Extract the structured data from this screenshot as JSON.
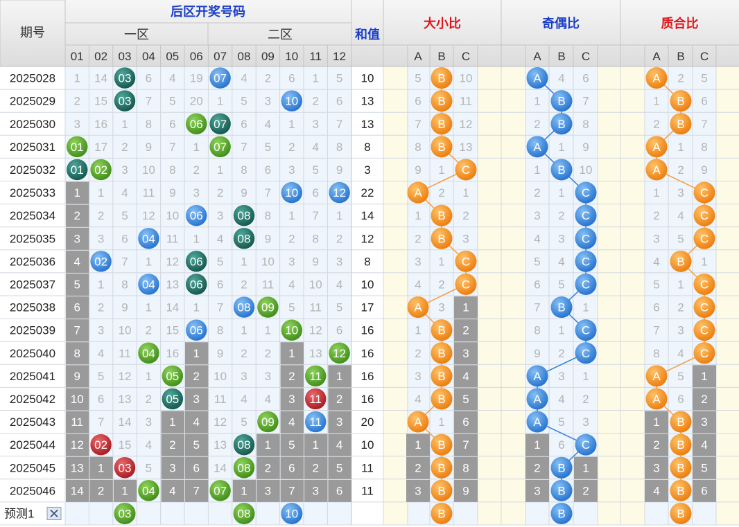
{
  "header": {
    "period_label": "期号",
    "back_title": "后区开奖号码",
    "zone1_label": "一区",
    "zone2_label": "二区",
    "sum_label": "和值",
    "size_title": "大小比",
    "parity_title": "奇偶比",
    "prime_title": "质合比",
    "numbers": [
      "01",
      "02",
      "03",
      "04",
      "05",
      "06",
      "07",
      "08",
      "09",
      "10",
      "11",
      "12"
    ],
    "abc": [
      "A",
      "B",
      "C"
    ]
  },
  "colors": {
    "blue_title": "#1a3ec8",
    "red_title": "#e0151b",
    "ball_dark_teal": "#1f6e63",
    "ball_green": "#55a92a",
    "ball_blue": "#3b8be0",
    "ball_red": "#c8282e",
    "ball_orange": "#f28a1c",
    "gray_cell": "#9a9a9a"
  },
  "prediction": {
    "label": "预测1",
    "close_icon": "close-icon",
    "numbers": [
      "03",
      "08",
      "10"
    ],
    "size": "B",
    "parity": "B",
    "prime": "B"
  },
  "chart_data": {
    "type": "table",
    "columns": [
      "期号",
      "01",
      "02",
      "03",
      "04",
      "05",
      "06",
      "07",
      "08",
      "09",
      "10",
      "11",
      "12",
      "和值",
      "大小比 A",
      "大小比 B",
      "大小比 C",
      "奇偶比 A",
      "奇偶比 B",
      "奇偶比 C",
      "质合比 A",
      "质合比 B",
      "质合比 C"
    ],
    "rows": [
      {
        "period": "2025028",
        "nums": [
          "1",
          "14",
          "03",
          "6",
          "4",
          "19",
          "07",
          "4",
          "2",
          "6",
          "1",
          "5"
        ],
        "balls": [
          3,
          7
        ],
        "sum": "10",
        "size": [
          "5",
          "B",
          "10"
        ],
        "parity": [
          "A",
          "4",
          "6"
        ],
        "prime": [
          "A",
          "2",
          "5"
        ]
      },
      {
        "period": "2025029",
        "nums": [
          "2",
          "15",
          "03",
          "7",
          "5",
          "20",
          "1",
          "5",
          "3",
          "10",
          "2",
          "6"
        ],
        "balls": [
          3,
          10
        ],
        "sum": "13",
        "size": [
          "6",
          "B",
          "11"
        ],
        "parity": [
          "1",
          "B",
          "7"
        ],
        "prime": [
          "1",
          "B",
          "6"
        ]
      },
      {
        "period": "2025030",
        "nums": [
          "3",
          "16",
          "1",
          "8",
          "6",
          "06",
          "07",
          "6",
          "4",
          "1",
          "3",
          "7"
        ],
        "balls": [
          6,
          7
        ],
        "sum": "13",
        "size": [
          "7",
          "B",
          "12"
        ],
        "parity": [
          "2",
          "B",
          "8"
        ],
        "prime": [
          "2",
          "B",
          "7"
        ]
      },
      {
        "period": "2025031",
        "nums": [
          "01",
          "17",
          "2",
          "9",
          "7",
          "1",
          "07",
          "7",
          "5",
          "2",
          "4",
          "8"
        ],
        "balls": [
          1,
          7
        ],
        "sum": "8",
        "size": [
          "8",
          "B",
          "13"
        ],
        "parity": [
          "A",
          "1",
          "9"
        ],
        "prime": [
          "A",
          "1",
          "8"
        ]
      },
      {
        "period": "2025032",
        "nums": [
          "01",
          "02",
          "3",
          "10",
          "8",
          "2",
          "1",
          "8",
          "6",
          "3",
          "5",
          "9"
        ],
        "balls": [
          1,
          2
        ],
        "sum": "3",
        "size": [
          "9",
          "1",
          "C"
        ],
        "parity": [
          "1",
          "B",
          "10"
        ],
        "prime": [
          "A",
          "2",
          "9"
        ]
      },
      {
        "period": "2025033",
        "nums": [
          "1",
          "1",
          "4",
          "11",
          "9",
          "3",
          "2",
          "9",
          "7",
          "10",
          "6",
          "12"
        ],
        "balls": [
          10,
          12
        ],
        "sum": "22",
        "size": [
          "A",
          "2",
          "1"
        ],
        "parity": [
          "2",
          "1",
          "C"
        ],
        "prime": [
          "1",
          "3",
          "C"
        ]
      },
      {
        "period": "2025034",
        "nums": [
          "2",
          "2",
          "5",
          "12",
          "10",
          "06",
          "3",
          "08",
          "8",
          "1",
          "7",
          "1"
        ],
        "balls": [
          6,
          8
        ],
        "sum": "14",
        "size": [
          "1",
          "B",
          "2"
        ],
        "parity": [
          "3",
          "2",
          "C"
        ],
        "prime": [
          "2",
          "4",
          "C"
        ]
      },
      {
        "period": "2025035",
        "nums": [
          "3",
          "3",
          "6",
          "04",
          "11",
          "1",
          "4",
          "08",
          "9",
          "2",
          "8",
          "2"
        ],
        "balls": [
          4,
          8
        ],
        "sum": "12",
        "size": [
          "2",
          "B",
          "3"
        ],
        "parity": [
          "4",
          "3",
          "C"
        ],
        "prime": [
          "3",
          "5",
          "C"
        ]
      },
      {
        "period": "2025036",
        "nums": [
          "4",
          "02",
          "7",
          "1",
          "12",
          "06",
          "5",
          "1",
          "10",
          "3",
          "9",
          "3"
        ],
        "balls": [
          2,
          6
        ],
        "sum": "8",
        "size": [
          "3",
          "1",
          "C"
        ],
        "parity": [
          "5",
          "4",
          "C"
        ],
        "prime": [
          "4",
          "B",
          "1"
        ]
      },
      {
        "period": "2025037",
        "nums": [
          "5",
          "1",
          "8",
          "04",
          "13",
          "06",
          "6",
          "2",
          "11",
          "4",
          "10",
          "4"
        ],
        "balls": [
          4,
          6
        ],
        "sum": "10",
        "size": [
          "4",
          "2",
          "C"
        ],
        "parity": [
          "6",
          "5",
          "C"
        ],
        "prime": [
          "5",
          "1",
          "C"
        ]
      },
      {
        "period": "2025038",
        "nums": [
          "6",
          "2",
          "9",
          "1",
          "14",
          "1",
          "7",
          "08",
          "09",
          "5",
          "11",
          "5"
        ],
        "balls": [
          8,
          9
        ],
        "sum": "17",
        "size": [
          "A",
          "3",
          "1"
        ],
        "parity": [
          "7",
          "B",
          "1"
        ],
        "prime": [
          "6",
          "2",
          "C"
        ]
      },
      {
        "period": "2025039",
        "nums": [
          "7",
          "3",
          "10",
          "2",
          "15",
          "06",
          "8",
          "1",
          "1",
          "10",
          "12",
          "6"
        ],
        "balls": [
          6,
          10
        ],
        "sum": "16",
        "size": [
          "1",
          "B",
          "2"
        ],
        "parity": [
          "8",
          "1",
          "C"
        ],
        "prime": [
          "7",
          "3",
          "C"
        ]
      },
      {
        "period": "2025040",
        "nums": [
          "8",
          "4",
          "11",
          "04",
          "16",
          "1",
          "9",
          "2",
          "2",
          "1",
          "13",
          "12"
        ],
        "balls": [
          4,
          12
        ],
        "sum": "16",
        "size": [
          "2",
          "B",
          "3"
        ],
        "parity": [
          "9",
          "2",
          "C"
        ],
        "prime": [
          "8",
          "4",
          "C"
        ]
      },
      {
        "period": "2025041",
        "nums": [
          "9",
          "5",
          "12",
          "1",
          "05",
          "2",
          "10",
          "3",
          "3",
          "2",
          "11",
          "1"
        ],
        "balls": [
          5,
          11
        ],
        "sum": "16",
        "size": [
          "3",
          "B",
          "4"
        ],
        "parity": [
          "A",
          "3",
          "1"
        ],
        "prime": [
          "A",
          "5",
          "1"
        ]
      },
      {
        "period": "2025042",
        "nums": [
          "10",
          "6",
          "13",
          "2",
          "05",
          "3",
          "11",
          "4",
          "4",
          "3",
          "11",
          "2"
        ],
        "balls": [
          5,
          11
        ],
        "sum": "16",
        "size": [
          "4",
          "B",
          "5"
        ],
        "parity": [
          "A",
          "4",
          "2"
        ],
        "prime": [
          "A",
          "6",
          "2"
        ]
      },
      {
        "period": "2025043",
        "nums": [
          "11",
          "7",
          "14",
          "3",
          "1",
          "4",
          "12",
          "5",
          "09",
          "4",
          "11",
          "3"
        ],
        "balls": [
          9,
          11
        ],
        "sum": "20",
        "size": [
          "A",
          "1",
          "6"
        ],
        "parity": [
          "A",
          "5",
          "3"
        ],
        "prime": [
          "1",
          "B",
          "3"
        ]
      },
      {
        "period": "2025044",
        "nums": [
          "12",
          "02",
          "15",
          "4",
          "2",
          "5",
          "13",
          "08",
          "1",
          "5",
          "1",
          "4"
        ],
        "balls": [
          2,
          8
        ],
        "sum": "10",
        "size": [
          "1",
          "B",
          "7"
        ],
        "parity": [
          "1",
          "6",
          "C"
        ],
        "prime": [
          "2",
          "B",
          "4"
        ]
      },
      {
        "period": "2025045",
        "nums": [
          "13",
          "1",
          "03",
          "5",
          "3",
          "6",
          "14",
          "08",
          "2",
          "6",
          "2",
          "5"
        ],
        "balls": [
          3,
          8
        ],
        "sum": "11",
        "size": [
          "2",
          "B",
          "8"
        ],
        "parity": [
          "2",
          "B",
          "1"
        ],
        "prime": [
          "3",
          "B",
          "5"
        ]
      },
      {
        "period": "2025046",
        "nums": [
          "14",
          "2",
          "1",
          "04",
          "4",
          "7",
          "07",
          "1",
          "3",
          "7",
          "3",
          "6"
        ],
        "balls": [
          4,
          7
        ],
        "sum": "11",
        "size": [
          "3",
          "B",
          "9"
        ],
        "parity": [
          "3",
          "B",
          "2"
        ],
        "prime": [
          "4",
          "B",
          "6"
        ]
      }
    ]
  }
}
